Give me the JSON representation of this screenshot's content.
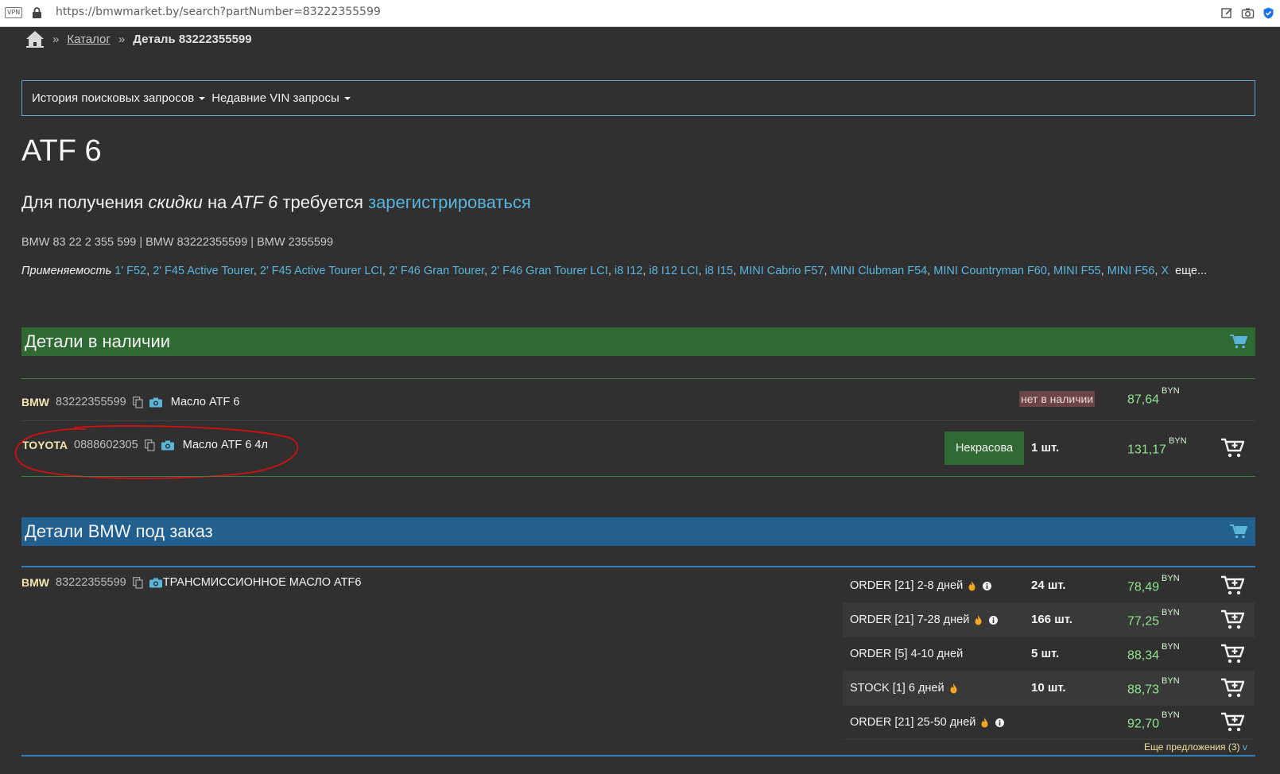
{
  "browser": {
    "vpn_badge": "VPN",
    "url": "https://bmwmarket.by/search?partNumber=83222355599"
  },
  "breadcrumb": {
    "home_icon": "home-icon",
    "sep": "»",
    "catalog": "Каталог",
    "current": "Деталь 83222355599"
  },
  "history_bar": {
    "search_history": "История поисковых запросов",
    "vin_history": "Недавние VIN запросы"
  },
  "page_title": "ATF 6",
  "promo": {
    "p1": "Для получения ",
    "p2": "скидки",
    "p3": " на ",
    "p4": "ATF 6",
    "p5": " требуется ",
    "link": "зарегистрироваться"
  },
  "codes": "BMW 83 22 2 355 599 | BMW 83222355599 | BMW 2355599",
  "applicability": {
    "label": "Применяемость",
    "models": [
      "1' F52",
      "2' F45 Active Tourer",
      "2' F45 Active Tourer LCI",
      "2' F46 Gran Tourer",
      "2' F46 Gran Tourer LCI",
      "i8 I12",
      "i8 I12 LCI",
      "i8 I15",
      "MINI Cabrio F57",
      "MINI Clubman F54",
      "MINI Countryman F60",
      "MINI F55",
      "MINI F56",
      "X"
    ],
    "more": "еще..."
  },
  "in_stock": {
    "title": "Детали в наличии",
    "rows": [
      {
        "brand": "BMW",
        "part_number": "83222355599",
        "description": "Масло ATF 6",
        "availability": "нет в наличии",
        "price": "87,64",
        "currency": "BYN"
      },
      {
        "brand": "TOYOTA",
        "part_number": "0888602305",
        "description": "Масло ATF 6 4л",
        "store": "Некрасова",
        "qty": "1 шт.",
        "price": "131,17",
        "currency": "BYN"
      }
    ]
  },
  "order": {
    "title": "Детали BMW под заказ",
    "item": {
      "brand": "BMW",
      "part_number": "83222355599",
      "description": "ТРАНСМИССИОННОЕ МАСЛО ATF6"
    },
    "offers": [
      {
        "label": "ORDER [21] 2-8 дней",
        "qty": "24 шт.",
        "price": "78,49",
        "currency": "BYN",
        "hot": true,
        "info": true
      },
      {
        "label": "ORDER [21] 7-28 дней",
        "qty": "166 шт.",
        "price": "77,25",
        "currency": "BYN",
        "hot": true,
        "info": true
      },
      {
        "label": "ORDER [5] 4-10 дней",
        "qty": "5 шт.",
        "price": "88,34",
        "currency": "BYN",
        "hot": false,
        "info": false
      },
      {
        "label": "STOCK [1] 6 дней",
        "qty": "10 шт.",
        "price": "88,73",
        "currency": "BYN",
        "hot": true,
        "info": false
      },
      {
        "label": "ORDER [21] 25-50 дней",
        "qty": "",
        "price": "92,70",
        "currency": "BYN",
        "hot": true,
        "info": true
      }
    ],
    "more_offers": "Еще предложения (3)"
  },
  "colors": {
    "background": "#303030",
    "link": "#5ab4dc",
    "green_section": "#2f6a33",
    "blue_section": "#21608f",
    "price": "#8fe38f",
    "annotation": "#d01010"
  }
}
